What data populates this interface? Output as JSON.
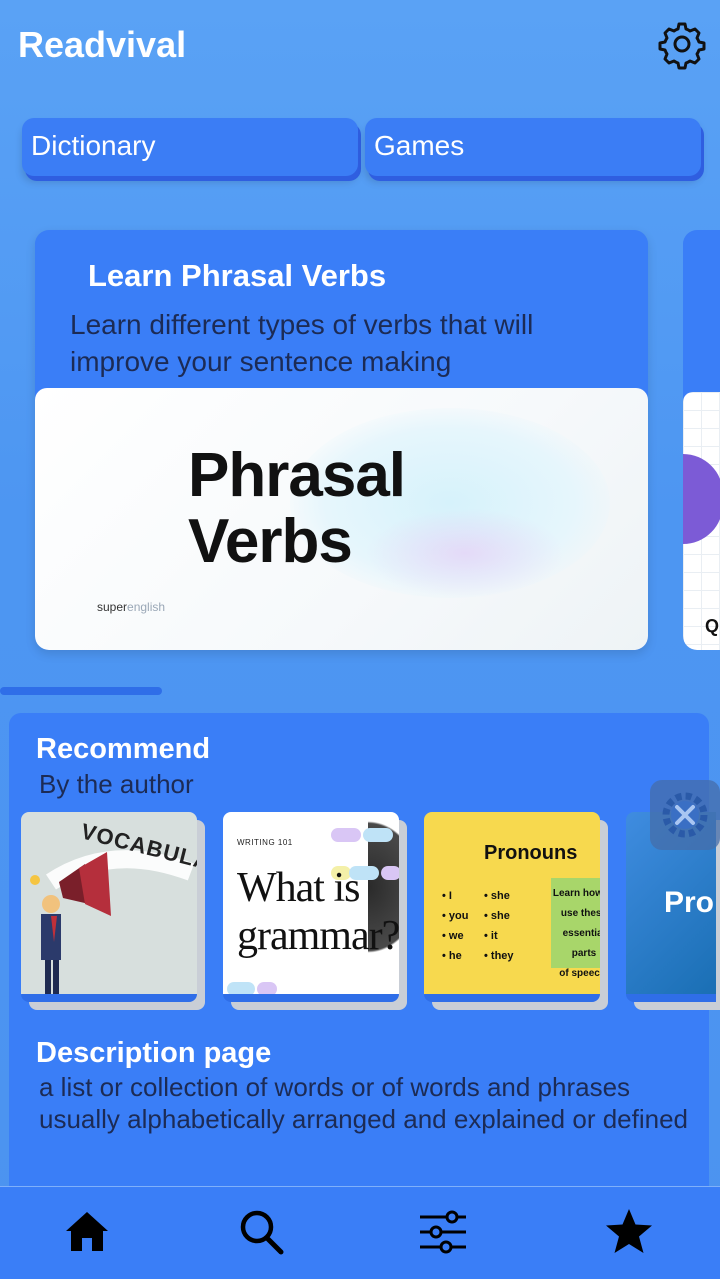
{
  "app": {
    "title": "Readvival"
  },
  "top_buttons": {
    "dictionary": "Dictionary",
    "games": "Games"
  },
  "feature_card": {
    "title": "Learn Phrasal Verbs",
    "description": "Learn different types of verbs that will improve your sentence making",
    "image": {
      "line1": "Phrasal",
      "line2": "Verbs",
      "brand_bold": "super",
      "brand_light": "english"
    }
  },
  "peek_card": {
    "letter": "Q"
  },
  "recommend": {
    "title": "Recommend",
    "subtitle": "By the author",
    "books": [
      {
        "cover_text": "VOCABULARY"
      },
      {
        "cover_small": "WRITING 101",
        "cover_title_1": "What is",
        "cover_title_2": "grammar?"
      },
      {
        "cover_title": "Pronouns",
        "col1": [
          "• I",
          "• you",
          "• we",
          "• he"
        ],
        "col2": [
          "• she",
          "• she",
          "• it",
          "• they"
        ],
        "box": [
          "Learn how to",
          "use these",
          "essential parts",
          "of speech."
        ]
      },
      {
        "cover_text": "Pror"
      }
    ]
  },
  "description": {
    "title": "Description page",
    "body": "a list or collection of words or of words and phrases usually alphabetically arranged and explained or defined"
  },
  "icons": {
    "settings": "gear-icon",
    "floating": "tools-gear-icon",
    "nav": [
      "home-icon",
      "search-icon",
      "sliders-icon",
      "star-icon"
    ]
  },
  "colors": {
    "background": "#4d96f2",
    "card": "#3a7ef7",
    "button_shadow": "#2f5ee0",
    "text_dark": "#1c2b55"
  }
}
